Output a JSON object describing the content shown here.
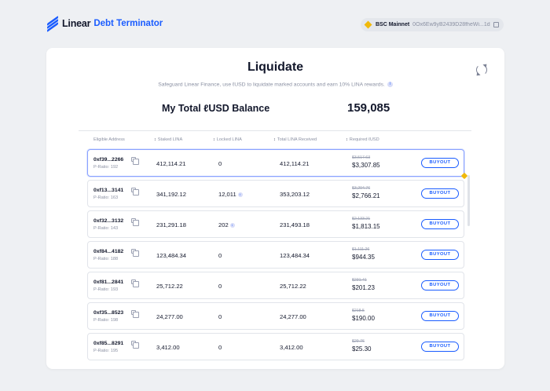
{
  "header": {
    "logo_name": "Linear",
    "logo_sub": "Debt Terminator",
    "network_name": "BSC Mainnet",
    "wallet_address": "0Ox6Ew9yB2439D28fheWi...1d2p"
  },
  "main": {
    "title": "Liquidate",
    "subtitle": "Safeguard Linear Finance, use ℓUSD to liquidate marked accounts and earn 10% LINA rewards.",
    "balance_label": "My Total ℓUSD Balance",
    "balance_value": "159,085",
    "columns": [
      "Eligible Address",
      "Staked LINA",
      "Locked LINA",
      "Total LINA Received",
      "Required ℓUSD"
    ],
    "buyout_label": "BUYOUT",
    "rows": [
      {
        "address": "0xf39...2266",
        "ratio": "P-Ratio: 192",
        "staked": "412,114.21",
        "locked": "0",
        "locked_info": false,
        "total": "412,114.21",
        "required_old": "$3,517.63",
        "required": "$3,307.85"
      },
      {
        "address": "0xf13...3141",
        "ratio": "P-Ratio: 163",
        "staked": "341,192.12",
        "locked": "12,011",
        "locked_info": true,
        "total": "353,203.12",
        "required_old": "$3,294.76",
        "required": "$2,766.21"
      },
      {
        "address": "0xf32...3132",
        "ratio": "P-Ratio: 143",
        "staked": "231,291.18",
        "locked": "202",
        "locked_info": true,
        "total": "231,493.18",
        "required_old": "$2,133.21",
        "required": "$1,813.15"
      },
      {
        "address": "0xf84...4182",
        "ratio": "P-Ratio: 188",
        "staked": "123,484.34",
        "locked": "0",
        "locked_info": false,
        "total": "123,484.34",
        "required_old": "$1,111.26",
        "required": "$944.35"
      },
      {
        "address": "0xf81...2841",
        "ratio": "P-Ratio: 193",
        "staked": "25,712.22",
        "locked": "0",
        "locked_info": false,
        "total": "25,712.22",
        "required_old": "$231.41",
        "required": "$201.23"
      },
      {
        "address": "0xf35...8523",
        "ratio": "P-Ratio: 198",
        "staked": "24,277.00",
        "locked": "0",
        "locked_info": false,
        "total": "24,277.00",
        "required_old": "$218.5",
        "required": "$190.00"
      },
      {
        "address": "0xf85...8291",
        "ratio": "P-Ratio: 195",
        "staked": "3,412.00",
        "locked": "0",
        "locked_info": false,
        "total": "3,412.00",
        "required_old": "$29.76",
        "required": "$25.30"
      }
    ]
  },
  "colors": {
    "accent": "#1a5cff",
    "background": "#eef0f3",
    "card": "#ffffff",
    "muted_text": "#8a90a2",
    "bsc_yellow": "#f0b90b"
  }
}
